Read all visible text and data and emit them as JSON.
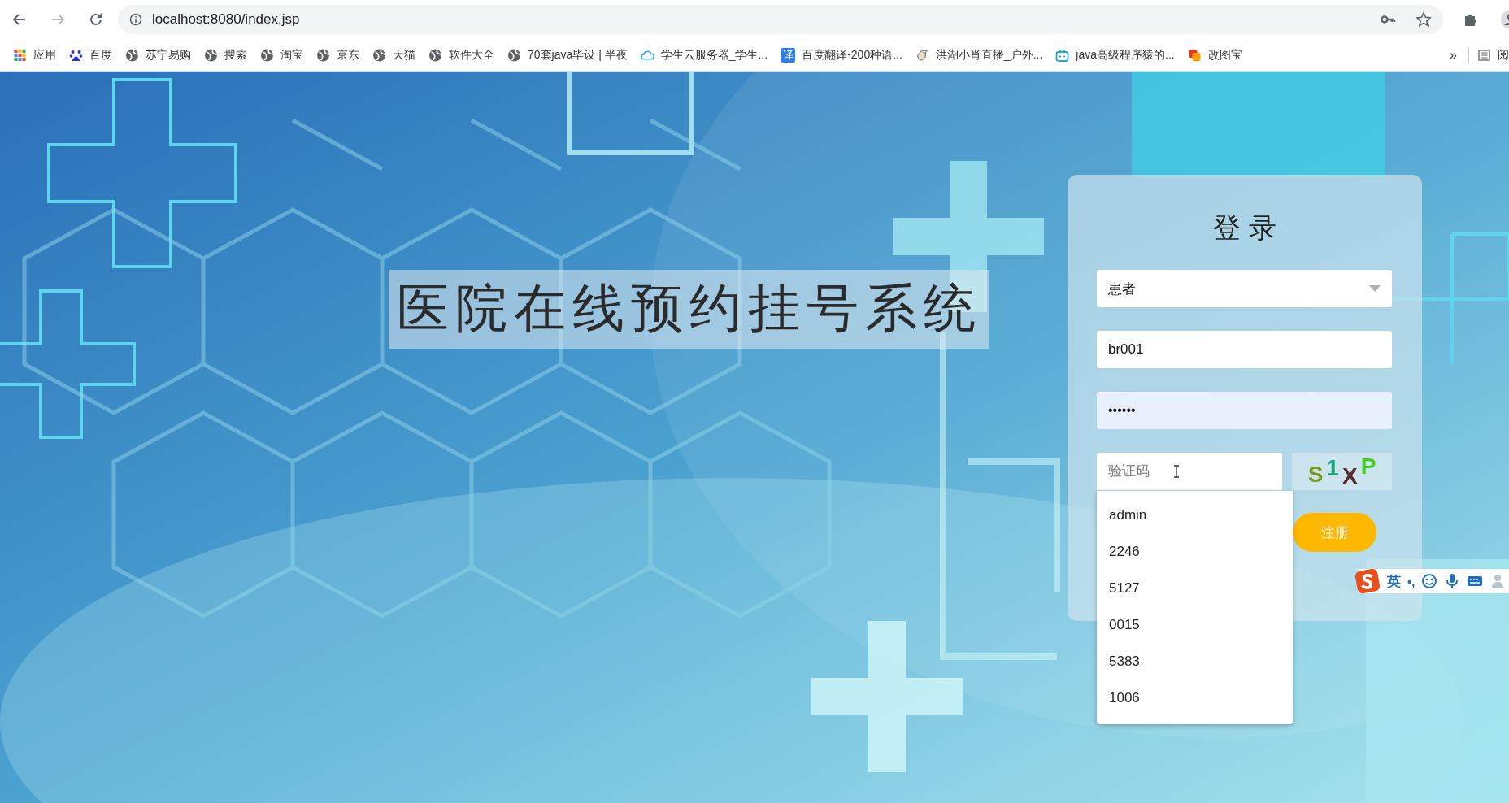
{
  "browser": {
    "address": "localhost:8080/index.jsp",
    "bookmarks": [
      {
        "kind": "apps",
        "label": "应用"
      },
      {
        "kind": "paw",
        "label": "百度"
      },
      {
        "kind": "globe",
        "label": "苏宁易购"
      },
      {
        "kind": "globe",
        "label": "搜索"
      },
      {
        "kind": "globe",
        "label": "淘宝"
      },
      {
        "kind": "globe",
        "label": "京东"
      },
      {
        "kind": "globe",
        "label": "天猫"
      },
      {
        "kind": "globe",
        "label": "软件大全"
      },
      {
        "kind": "globe",
        "label": "70套java毕设 | 半夜"
      },
      {
        "kind": "cloud",
        "label": "学生云服务器_学生..."
      },
      {
        "kind": "badge",
        "badge_text": "译",
        "label": "百度翻译-200种语..."
      },
      {
        "kind": "bird",
        "label": "洪湖小肖直播_户外..."
      },
      {
        "kind": "tv",
        "label": "java高级程序猿的..."
      },
      {
        "kind": "squares",
        "label": "改图宝"
      }
    ],
    "overflow": "»",
    "reading_list": "阅"
  },
  "page": {
    "title": "医院在线预约挂号系统",
    "login": {
      "heading": "登 录",
      "role": "患者",
      "username": "br001",
      "password": "••••••",
      "captcha_placeholder": "验证码",
      "captcha_code": "S1XP",
      "register": "注册",
      "suggestions": [
        "admin",
        "2246",
        "5127",
        "0015",
        "5383",
        "1006"
      ]
    },
    "ime": {
      "mode": "英",
      "punct": "•,"
    }
  }
}
